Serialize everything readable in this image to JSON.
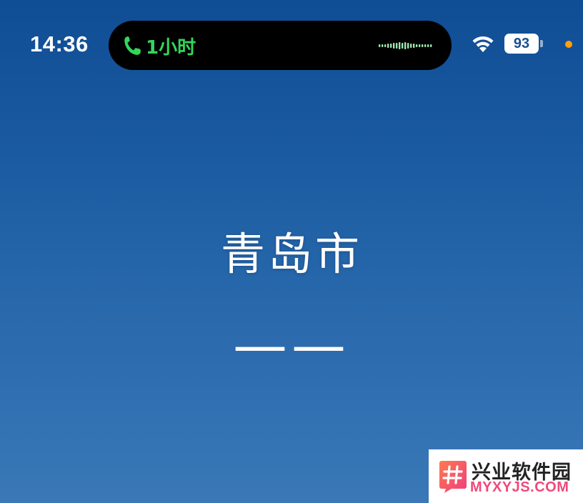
{
  "status_bar": {
    "time": "14:36",
    "call_duration": "1小时",
    "battery_level": "93"
  },
  "weather": {
    "city": "青岛市",
    "temperature": "——"
  },
  "watermark": {
    "title": "兴业软件园",
    "url": "MYXYJS.COM"
  },
  "colors": {
    "background_top": "#0f4d94",
    "background_bottom": "#3a78b7",
    "call_green": "#33d65a",
    "mic_indicator": "#ff9f0a",
    "watermark_pink": "#ef4a7a"
  },
  "icons": [
    "phone-icon",
    "waveform-icon",
    "wifi-icon",
    "battery-icon",
    "microphone-indicator-icon",
    "watermark-logo-icon"
  ]
}
